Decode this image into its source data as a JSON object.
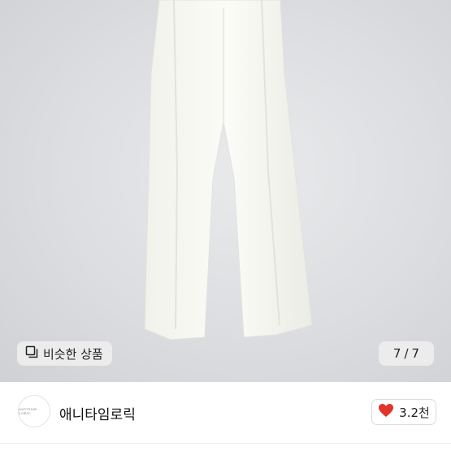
{
  "image": {
    "subject": "white-pants-photo"
  },
  "similar_button": {
    "label": "비슷한 상품",
    "icon": "similar-items-icon"
  },
  "image_counter": {
    "current": "7",
    "separator": "/",
    "total": "7"
  },
  "seller": {
    "name": "애니타임로릭",
    "logo_text": "ANYTIME LORIC"
  },
  "like": {
    "count": "3.2천",
    "icon": "heart-icon",
    "color": "#e0352b"
  }
}
